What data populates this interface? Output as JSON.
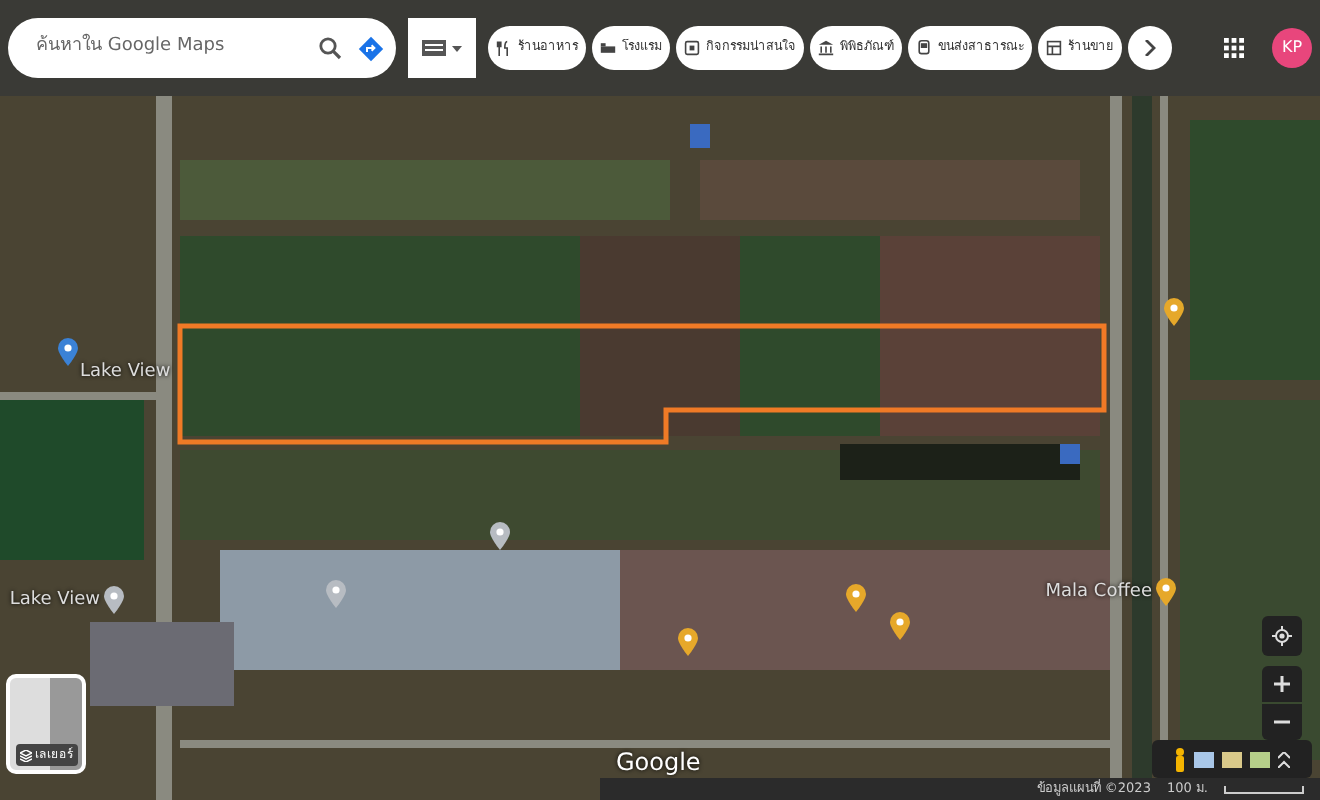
{
  "search": {
    "placeholder": "ค้นหาใน Google Maps"
  },
  "chips": [
    {
      "label": "ร้านอาหาร"
    },
    {
      "label": "โรงแรม"
    },
    {
      "label": "กิจกรรมน่าสนใจ"
    },
    {
      "label": "พิพิธภัณฑ์"
    },
    {
      "label": "ขนส่งสาธารณะ"
    },
    {
      "label": "ร้านขาย"
    }
  ],
  "account": {
    "initials": "KP"
  },
  "pins": [
    {
      "kind": "transit",
      "label": "Lake View"
    },
    {
      "kind": "place",
      "label": "Lake View"
    },
    {
      "kind": "food",
      "label": "Mala Coffee"
    },
    {
      "kind": "food"
    },
    {
      "kind": "food"
    },
    {
      "kind": "food"
    },
    {
      "kind": "food"
    },
    {
      "kind": "place"
    },
    {
      "kind": "place"
    }
  ],
  "layers": {
    "label": "เลเยอร์"
  },
  "logo": "Google",
  "footer": {
    "attribution": "ข้อมูลแผนที่ ©2023",
    "scale": "100 ม."
  }
}
